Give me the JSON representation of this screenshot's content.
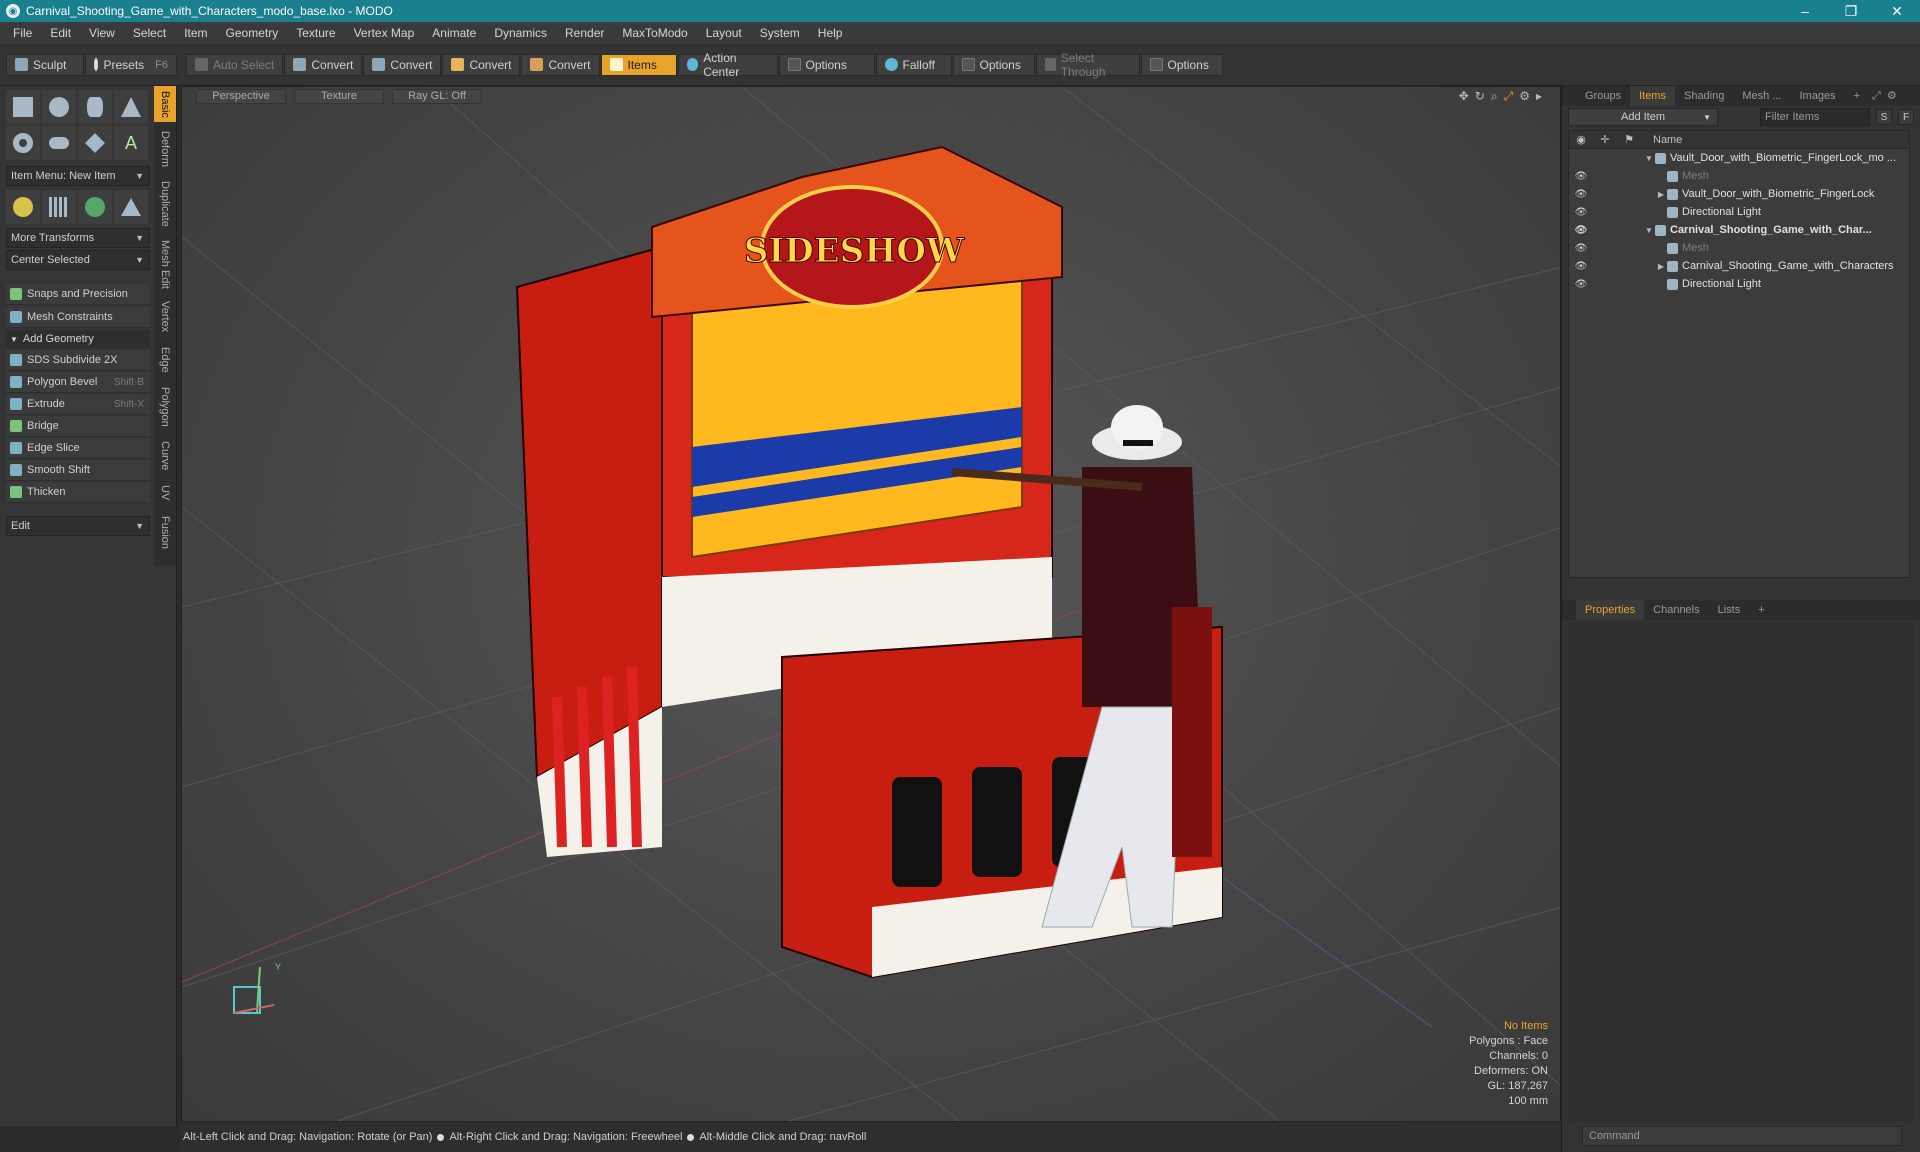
{
  "window": {
    "title": "Carnival_Shooting_Game_with_Characters_modo_base.lxo - MODO",
    "controls": [
      "–",
      "❐",
      "✕"
    ]
  },
  "menu": [
    "File",
    "Edit",
    "View",
    "Select",
    "Item",
    "Geometry",
    "Texture",
    "Vertex Map",
    "Animate",
    "Dynamics",
    "Render",
    "MaxToModo",
    "Layout",
    "System",
    "Help"
  ],
  "toolbar": {
    "sculpt": "Sculpt",
    "presets": "Presets",
    "presets_key": "F6",
    "auto_select": "Auto Select",
    "convert1": "Convert",
    "convert2": "Convert",
    "convert3": "Convert",
    "convert4": "Convert",
    "items": "Items",
    "action_center": "Action Center",
    "options1": "Options",
    "falloff": "Falloff",
    "options2": "Options",
    "select_through": "Select Through",
    "options3": "Options"
  },
  "left": {
    "vtabs": [
      "Basic",
      "Deform",
      "Duplicate",
      "Mesh Edit",
      "Vertex",
      "Edge",
      "Polygon",
      "Curve",
      "UV",
      "Fusion"
    ],
    "item_menu": "Item Menu: New Item",
    "more_transforms": "More Transforms",
    "center_selected": "Center Selected",
    "snaps": "Snaps and Precision",
    "mesh_constraints": "Mesh Constraints",
    "add_geometry": "Add Geometry",
    "tools": [
      {
        "label": "SDS Subdivide 2X",
        "key": ""
      },
      {
        "label": "Polygon Bevel",
        "key": "Shift-B"
      },
      {
        "label": "Extrude",
        "key": "Shift-X"
      },
      {
        "label": "Bridge",
        "key": ""
      },
      {
        "label": "Edge Slice",
        "key": ""
      },
      {
        "label": "Smooth Shift",
        "key": ""
      },
      {
        "label": "Thicken",
        "key": ""
      }
    ],
    "edit": "Edit"
  },
  "viewport": {
    "perspective": "Perspective",
    "texture": "Texture",
    "raygl": "Ray GL: Off",
    "hud": {
      "no_items": "No Items",
      "polygons": "Polygons : Face",
      "channels": "Channels: 0",
      "deformers": "Deformers: ON",
      "gl": "GL: 187,267",
      "scale": "100 mm"
    },
    "axis_y": "Y"
  },
  "status": {
    "s1": "Alt-Left Click and Drag: Navigation: Rotate (or Pan)",
    "s2": "Alt-Right Click and Drag: Navigation: Freewheel",
    "s3": "Alt-Middle Click and Drag: navRoll"
  },
  "right": {
    "tabs": [
      "Groups",
      "Items",
      "Shading",
      "Mesh ...",
      "Images"
    ],
    "add_item": "Add Item",
    "filter_items": "Filter Items",
    "btn_s": "S",
    "btn_f": "F",
    "name_col": "Name",
    "rows": [
      {
        "label": "Vault_Door_with_Biometric_FingerLock_mo ...",
        "indent": 0,
        "tri": "▼",
        "dim": false,
        "bold": false,
        "vis": ""
      },
      {
        "label": "Mesh",
        "indent": 1,
        "tri": "",
        "dim": true,
        "bold": false,
        "vis": "👁"
      },
      {
        "label": "Vault_Door_with_Biometric_FingerLock",
        "indent": 1,
        "tri": "▶",
        "dim": false,
        "bold": false,
        "vis": "👁"
      },
      {
        "label": "Directional Light",
        "indent": 1,
        "tri": "",
        "dim": false,
        "bold": false,
        "vis": "👁"
      },
      {
        "label": "Carnival_Shooting_Game_with_Char...",
        "indent": 0,
        "tri": "▼",
        "dim": false,
        "bold": true,
        "vis": "👁"
      },
      {
        "label": "Mesh",
        "indent": 1,
        "tri": "",
        "dim": true,
        "bold": false,
        "vis": "👁"
      },
      {
        "label": "Carnival_Shooting_Game_with_Characters",
        "indent": 1,
        "tri": "▶",
        "dim": false,
        "bold": false,
        "vis": "👁"
      },
      {
        "label": "Directional Light",
        "indent": 1,
        "tri": "",
        "dim": false,
        "bold": false,
        "vis": "👁"
      }
    ],
    "props_tabs": [
      "Properties",
      "Channels",
      "Lists"
    ],
    "command_placeholder": "Command"
  },
  "colors": {
    "accent": "#e8a42a",
    "titlebar": "#1a7f8e"
  }
}
